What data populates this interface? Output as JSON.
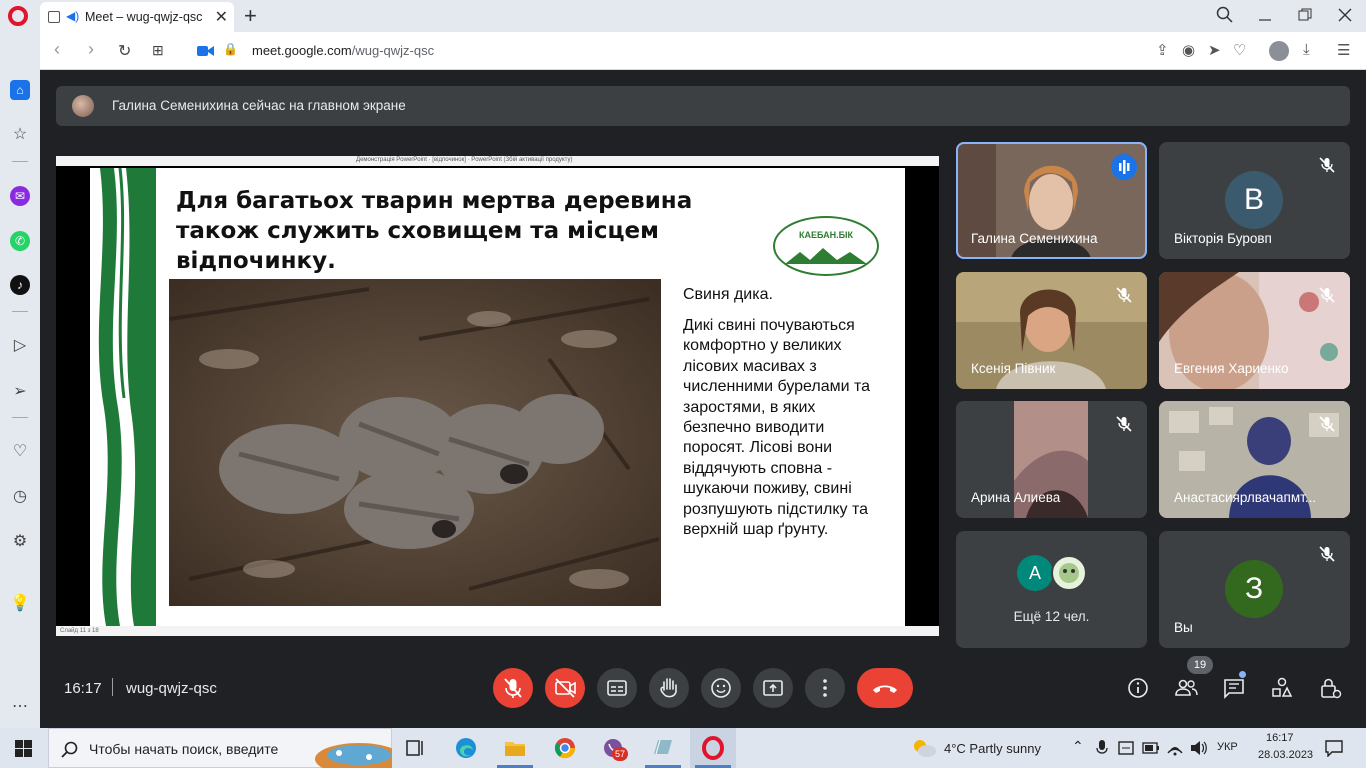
{
  "browser": {
    "tab_title": "Meet – wug-qwjz-qsc",
    "new_tab": "+",
    "url_domain": "meet.google.com",
    "url_path": "/wug-qwjz-qsc"
  },
  "meet": {
    "presenter_banner": "Галина Семенихина сейчас на главном экране",
    "slide_window_title": "Демонстрація PowerPoint · [відпочинок] · PowerPoint (Збій активації продукту)",
    "slide_status": "Слайд 11 з 18",
    "slide": {
      "heading": "Для багатьох тварин мертва деревина також служить сховищем та місцем відпочинку.",
      "logo_text": "КАЕБАН.БІК",
      "subtitle": "Свиня дика.",
      "body": "Дикі свині почуваються комфортно у великих лісових масивах з численними бурелами та заростями, в яких безпечно виводити поросят. Лісові вони віддячують сповна - шукаючи поживу, свині розпушують підстилку та верхній шар ґрунту."
    },
    "participants": [
      {
        "name": "Галина Семенихина",
        "speaking": true
      },
      {
        "name": "Вікторія Буровп",
        "initial": "В",
        "color": "#3c5a6e",
        "muted": true
      },
      {
        "name": "Ксенія Півник",
        "muted": true
      },
      {
        "name": "Евгения Хариенко",
        "muted": true
      },
      {
        "name": "Арина Алиева",
        "muted": true
      },
      {
        "name": "Анастасиярлвачапмт...",
        "muted": true
      },
      {
        "more_initial": "А",
        "more_label": "Ещё 12 чел."
      },
      {
        "name": "Вы",
        "initial": "З",
        "color": "#33691e",
        "muted": true
      }
    ],
    "clock": "16:17",
    "meeting_code": "wug-qwjz-qsc",
    "people_count": "19",
    "controls": [
      "mic-off",
      "camera-off",
      "captions",
      "raise-hand",
      "emoji",
      "present",
      "more",
      "end-call"
    ],
    "right_controls": [
      "info",
      "people",
      "chat",
      "activities",
      "host-controls"
    ]
  },
  "taskbar": {
    "search_placeholder": "Чтобы начать поиск, введите",
    "weather": "4°C  Partly sunny",
    "language": "УКР",
    "time": "16:17",
    "date": "28.03.2023",
    "viber_badge": "57"
  },
  "colors": {
    "accent": "#1a73e8",
    "danger": "#ea4335",
    "meet_bg": "#202124",
    "tile_bg": "#3c4043"
  }
}
